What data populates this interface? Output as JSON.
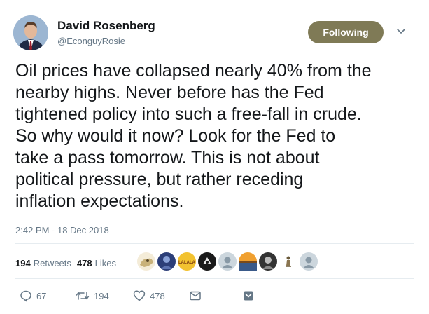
{
  "author": {
    "name": "David Rosenberg",
    "handle": "@EconguyRosie"
  },
  "follow_button": {
    "label": "Following"
  },
  "tweet": {
    "text": "Oil prices have collapsed nearly 40% from the\nnearby highs. Never before has the Fed\ntightened policy into such a free-fall in crude.\nSo why would it now? Look for the Fed to\ntake a pass tomorrow. This is not about\npolitical pressure, but rather receding\ninflation expectations.",
    "timestamp": "2:42 PM - 18 Dec 2018"
  },
  "stats": {
    "retweets_count": "194",
    "retweets_label": "Retweets",
    "likes_count": "478",
    "likes_label": "Likes"
  },
  "liker_avatars": [
    {
      "icon": "cartoon-avatar",
      "color": "#c9b27a"
    },
    {
      "icon": "dark-photo-avatar",
      "color": "#2c3e78"
    },
    {
      "icon": "lalala-avatar",
      "color": "#f2c230",
      "text": "LALALA"
    },
    {
      "icon": "dark-avatar",
      "color": "#1a1a1a"
    },
    {
      "icon": "default-avatar",
      "color": "#aab8c2"
    },
    {
      "icon": "landscape-avatar",
      "color": "#b07a3a"
    },
    {
      "icon": "black-white-avatar",
      "color": "#333333"
    },
    {
      "icon": "figure-avatar",
      "color": "#e8e8e8"
    },
    {
      "icon": "default-avatar",
      "color": "#aab8c2"
    }
  ],
  "actions": {
    "replies": "67",
    "retweets": "194",
    "likes": "478"
  },
  "colors": {
    "follow_button_bg": "#7f7a56",
    "muted_text": "#657786",
    "divider": "#e6ecf0"
  }
}
